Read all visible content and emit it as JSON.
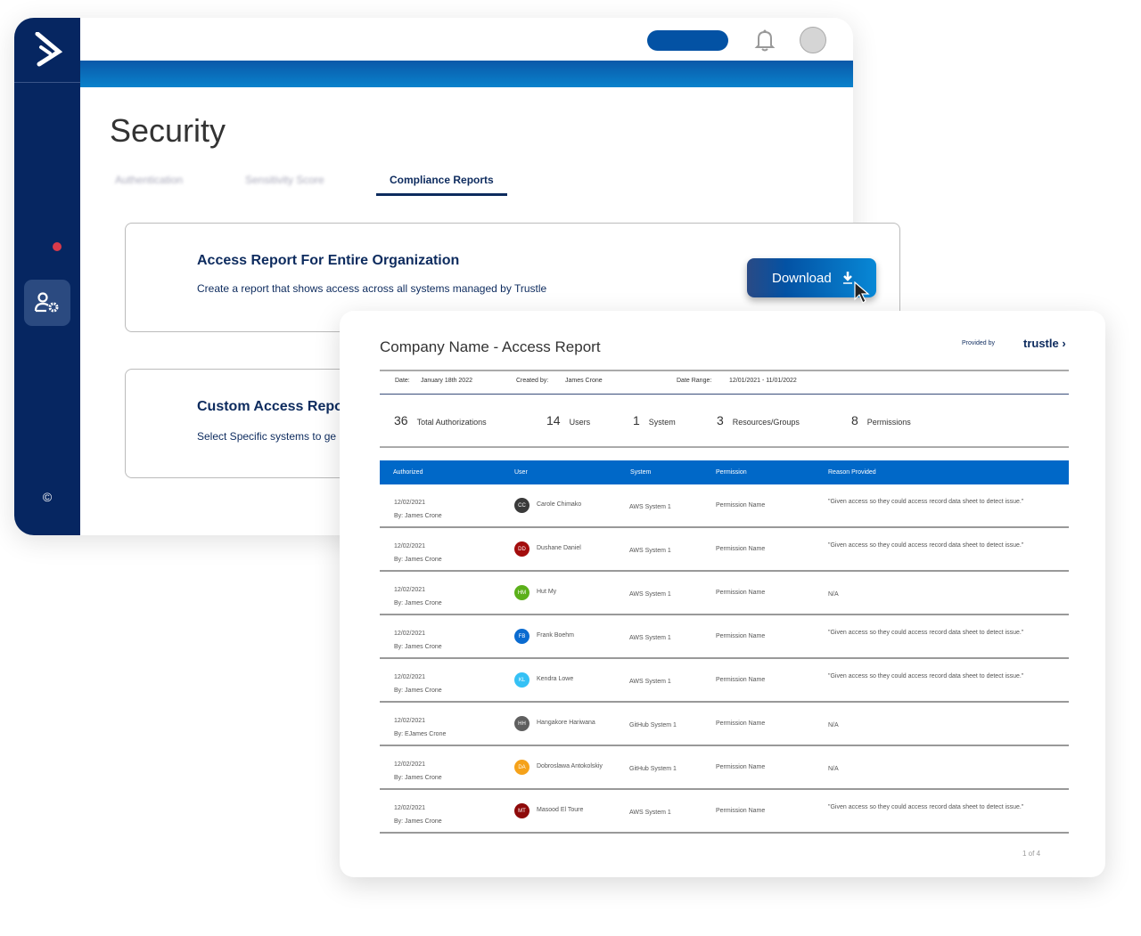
{
  "app": {
    "title": "Security",
    "tabs": [
      {
        "label": "Authentication"
      },
      {
        "label": "Sensitivity Score"
      },
      {
        "label": "Compliance Reports"
      }
    ],
    "copyright": "©"
  },
  "cards": [
    {
      "title": "Access Report For Entire Organization",
      "desc": "Create a report that shows access across all systems managed by Trustle",
      "button": "Download"
    },
    {
      "title": "Custom Access Report",
      "desc": "Select Specific systems to ge"
    }
  ],
  "report": {
    "title": "Company Name - Access Report",
    "provided_by": "Provided by",
    "brand": "trustle",
    "meta": {
      "date_label": "Date:",
      "date": "January 18th 2022",
      "created_label": "Created by:",
      "created": "James Crone",
      "range_label": "Date Range:",
      "range": "12/01/2021 - 11/01/2022"
    },
    "stats": [
      {
        "value": "36",
        "label": "Total Authorizations"
      },
      {
        "value": "14",
        "label": "Users"
      },
      {
        "value": "1",
        "label": "System"
      },
      {
        "value": "3",
        "label": "Resources/Groups"
      },
      {
        "value": "8",
        "label": "Permissions"
      }
    ],
    "columns": [
      "Authorized",
      "User",
      "System",
      "Permission",
      "Reason Provided"
    ],
    "rows": [
      {
        "date": "12/02/2021",
        "by": "By: James Crone",
        "initials": "CC",
        "color": "#3a3a3a",
        "user": "Carole Chimako",
        "system": "AWS System 1",
        "permission": "Permission Name",
        "reason": "\"Given access so they could access record data sheet to detect issue.\""
      },
      {
        "date": "12/02/2021",
        "by": "By: James Crone",
        "initials": "DD",
        "color": "#a30d0d",
        "user": "Dushane Daniel",
        "system": "AWS System 1",
        "permission": "Permission Name",
        "reason": "\"Given access so they could access record data sheet to detect issue.\""
      },
      {
        "date": "12/02/2021",
        "by": "By: James Crone",
        "initials": "HM",
        "color": "#5bb01a",
        "user": "Hut My",
        "system": "AWS System 1",
        "permission": "Permission Name",
        "reason": "N/A"
      },
      {
        "date": "12/02/2021",
        "by": "By: James Crone",
        "initials": "FB",
        "color": "#0a6bd0",
        "user": "Frank Boehm",
        "system": "AWS System 1",
        "permission": "Permission Name",
        "reason": "\"Given access so they could access record data sheet to detect issue.\""
      },
      {
        "date": "12/02/2021",
        "by": "By: James Crone",
        "initials": "KL",
        "color": "#35c1f5",
        "user": "Kendra Lowe",
        "system": "AWS System 1",
        "permission": "Permission Name",
        "reason": "\"Given access so they could access record data sheet to detect issue.\""
      },
      {
        "date": "12/02/2021",
        "by": "By: EJames Crone",
        "initials": "HH",
        "color": "#5f5f5f",
        "user": "Hangakore Hariwana",
        "system": "GitHub System 1",
        "permission": "Permission Name",
        "reason": "N/A"
      },
      {
        "date": "12/02/2021",
        "by": "By: James Crone",
        "initials": "DA",
        "color": "#f5a21a",
        "user": "Dobroslawa Antokolskiy",
        "system": "GitHub System 1",
        "permission": "Permission Name",
        "reason": "N/A"
      },
      {
        "date": "12/02/2021",
        "by": "By: James Crone",
        "initials": "MT",
        "color": "#8e0a0a",
        "user": "Masood El Toure",
        "system": "AWS System 1",
        "permission": "Permission Name",
        "reason": "\"Given access so they could access record data sheet to detect issue.\""
      }
    ],
    "pagination": "1 of 4"
  }
}
